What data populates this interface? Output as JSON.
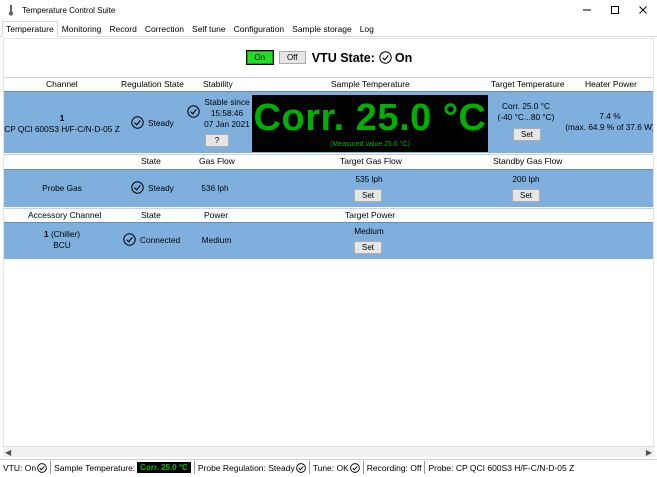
{
  "window": {
    "title": "Temperature Control Suite",
    "min_icon": "minimize-icon",
    "max_icon": "maximize-icon",
    "close_icon": "close-icon"
  },
  "tabs": [
    "Temperature",
    "Monitoring",
    "Record",
    "Correction",
    "Self tune",
    "Configuration",
    "Sample storage",
    "Log"
  ],
  "vtu": {
    "on_label": "On",
    "off_label": "Off",
    "state_label": "VTU State:",
    "state_value": "On"
  },
  "channel_table": {
    "headers": [
      "Channel",
      "Regulation State",
      "Stability",
      "Sample Temperature",
      "Target Temperature",
      "Heater Power"
    ],
    "channel_number": "1",
    "channel_name": "CP QCI 600S3 H/F-C/N-D-05 Z",
    "regulation_state": "Steady",
    "stability_line1": "Stable since",
    "stability_line2": "15:58:46",
    "stability_line3": "07 Jan 2021",
    "stability_button": "?",
    "display_value": "Corr. 25.0 °C",
    "display_sub": "(Measured value 25.6 °C)",
    "target_line1": "Corr. 25.0 °C",
    "target_line2": "(-40 °C...80 °C)",
    "target_button": "Set",
    "heater_line1": "7.4 %",
    "heater_line2": "(max. 64.9 % of 37.6 W)"
  },
  "gas_table": {
    "headers": [
      "State",
      "Gas Flow",
      "Target Gas Flow",
      "Standby Gas Flow"
    ],
    "name": "Probe Gas",
    "state": "Steady",
    "gas_flow": "536 lph",
    "target_gas_flow": "535 lph",
    "target_button": "Set",
    "standby_gas_flow": "200 lph",
    "standby_button": "Set"
  },
  "accessory_table": {
    "headers": [
      "Accessory Channel",
      "State",
      "Power",
      "Target Power"
    ],
    "channel_number": "1",
    "channel_suffix": "(Chiller)",
    "channel_name": "BCU",
    "state": "Connected",
    "power": "Medium",
    "target_power": "Medium",
    "target_button": "Set"
  },
  "statusbar": {
    "vtu": "VTU: On",
    "sample_label": "Sample Temperature:",
    "sample_value": "Corr.  25.0 °C",
    "probe_regulation": "Probe Regulation: Steady",
    "tune": "Tune: OK",
    "recording": "Recording: Off",
    "probe": "Probe: CP QCI 600S3 H/F-C/N-D-05 Z"
  },
  "colors": {
    "band": "#7fb0dd",
    "on_button": "#22dd22",
    "display_bg": "#000000",
    "display_text": "#00b000"
  }
}
